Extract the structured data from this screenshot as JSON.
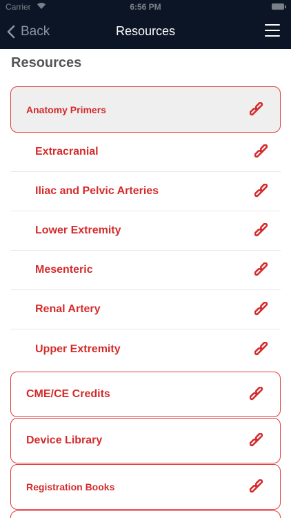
{
  "status_bar": {
    "carrier": "Carrier",
    "time": "6:56 PM"
  },
  "nav": {
    "back_label": "Back",
    "title": "Resources"
  },
  "section_title": "Resources",
  "anatomy": {
    "label": "Anatomy Primers"
  },
  "sub_items": [
    {
      "label": "Extracranial"
    },
    {
      "label": "Iliac and Pelvic Arteries"
    },
    {
      "label": "Lower Extremity"
    },
    {
      "label": "Mesenteric"
    },
    {
      "label": "Renal Artery"
    },
    {
      "label": "Upper Extremity"
    }
  ],
  "cards": [
    {
      "label": "CME/CE Credits"
    },
    {
      "label": "Device Library"
    },
    {
      "label": "Registration Books"
    }
  ],
  "colors": {
    "accent": "#d42b2b",
    "header": "#0c1526",
    "expanded_bg": "#efefef"
  },
  "icons": {
    "link": "link-icon",
    "back": "chevron-left-icon",
    "menu": "hamburger-menu-icon"
  }
}
